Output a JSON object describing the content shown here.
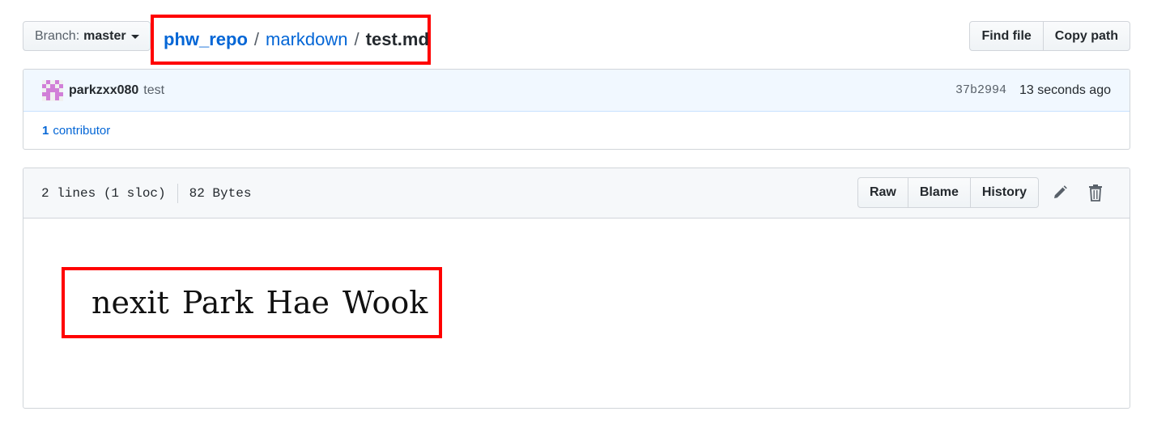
{
  "branch": {
    "prefix": "Branch:",
    "name": "master"
  },
  "breadcrumb": {
    "repo": "phw_repo",
    "sep1": "/",
    "dir": "markdown",
    "sep2": "/",
    "file": "test.md"
  },
  "top_buttons": {
    "find_file": "Find file",
    "copy_path": "Copy path"
  },
  "commit": {
    "author": "parkzxx080",
    "message": "test",
    "sha": "37b2994",
    "time": "13 seconds ago"
  },
  "contributors": {
    "count": "1",
    "label": "contributor"
  },
  "file": {
    "lines": "2 lines (1 sloc)",
    "size": "82 Bytes",
    "raw": "Raw",
    "blame": "Blame",
    "history": "History",
    "edit_icon": "pencil-icon",
    "delete_icon": "trash-icon",
    "content": "nexit Park Hae Wook"
  },
  "colors": {
    "link": "#0366d6",
    "highlight": "#ff0000",
    "avatar": "#d17fd8"
  }
}
